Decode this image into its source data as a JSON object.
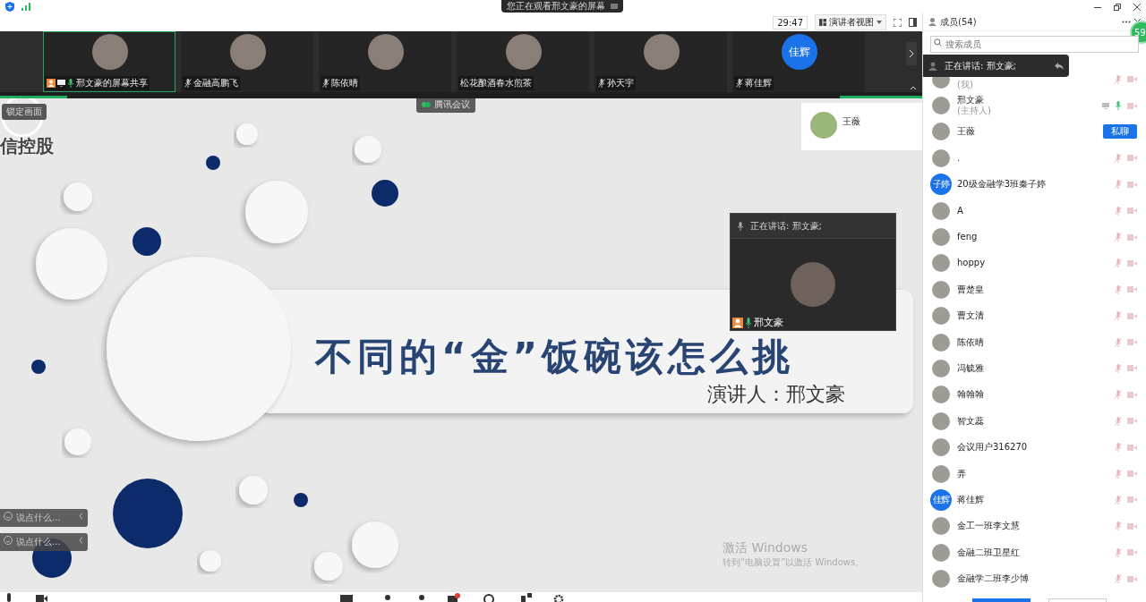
{
  "window": {
    "sharing_banner": "您正在观看邢文豪的屏幕"
  },
  "toolbar": {
    "timer": "29:47",
    "view_button": "演讲者视图"
  },
  "video_strip": [
    {
      "name": "邢文豪的屏幕共享",
      "selected": true,
      "muted": false,
      "screen_share": true
    },
    {
      "name": "金融高鹏飞",
      "selected": false,
      "muted": true
    },
    {
      "name": "陈依晴",
      "selected": false,
      "muted": true
    },
    {
      "name": "松花酿酒春水煎茶",
      "selected": false
    },
    {
      "name": "孙天宇",
      "selected": false,
      "muted": true
    },
    {
      "name": "蒋佳辉",
      "selected": false,
      "muted": true,
      "avatar_text": "佳辉"
    }
  ],
  "slide": {
    "logo_text": "信控股",
    "title": "不同的“金”饭碗该怎么挑",
    "speaker": "演讲人：邢文豪"
  },
  "overlays": {
    "lock_button": "锁定画面",
    "app_tag": "腾讯会议",
    "pinned_video": {
      "name": "王薇"
    },
    "speaker_popup": {
      "label": "正在讲话: 邢文豪;",
      "name": "邢文豪"
    },
    "chat_inputs": [
      {
        "placeholder": "说点什么..."
      },
      {
        "placeholder": "说点什么..."
      }
    ],
    "activation_notice": {
      "title": "激活 Windows",
      "subtitle": "转到“电脑设置”以激活 Windows。"
    }
  },
  "members_panel": {
    "title": "成员(54)",
    "badge": "59",
    "search": {
      "placeholder": "搜索成员"
    },
    "speaking_tip": "正在讲话: 邢文豪;",
    "members": [
      {
        "note": "(我)",
        "muted": true
      },
      {
        "name": "邢文豪",
        "note": "(主持人)",
        "muted": false,
        "screen_share": true
      },
      {
        "name": "王薇",
        "action": "私聊"
      },
      {
        "name": ".",
        "muted": true
      },
      {
        "name": "20级金融学3班秦子婷",
        "muted": true,
        "avatar_text": "子婷"
      },
      {
        "name": "A",
        "muted": true
      },
      {
        "name": "feng",
        "muted": true
      },
      {
        "name": "hoppy",
        "muted": true
      },
      {
        "name": "曹楚皇",
        "muted": true
      },
      {
        "name": "曹文清",
        "muted": true
      },
      {
        "name": "陈依晴",
        "muted": true
      },
      {
        "name": "冯毓雅",
        "muted": true
      },
      {
        "name": "翰翰翰",
        "muted": true
      },
      {
        "name": "智文蕊",
        "muted": true
      },
      {
        "name": "会议用户316270",
        "muted": true
      },
      {
        "name": "弄",
        "muted": true
      },
      {
        "name": "蒋佳辉",
        "muted": true,
        "avatar_text": "佳辉"
      },
      {
        "name": "金工一班李文慧",
        "muted": true
      },
      {
        "name": "金融二班卫星红",
        "muted": true
      },
      {
        "name": "金融学二班李少博",
        "muted": true
      }
    ]
  }
}
